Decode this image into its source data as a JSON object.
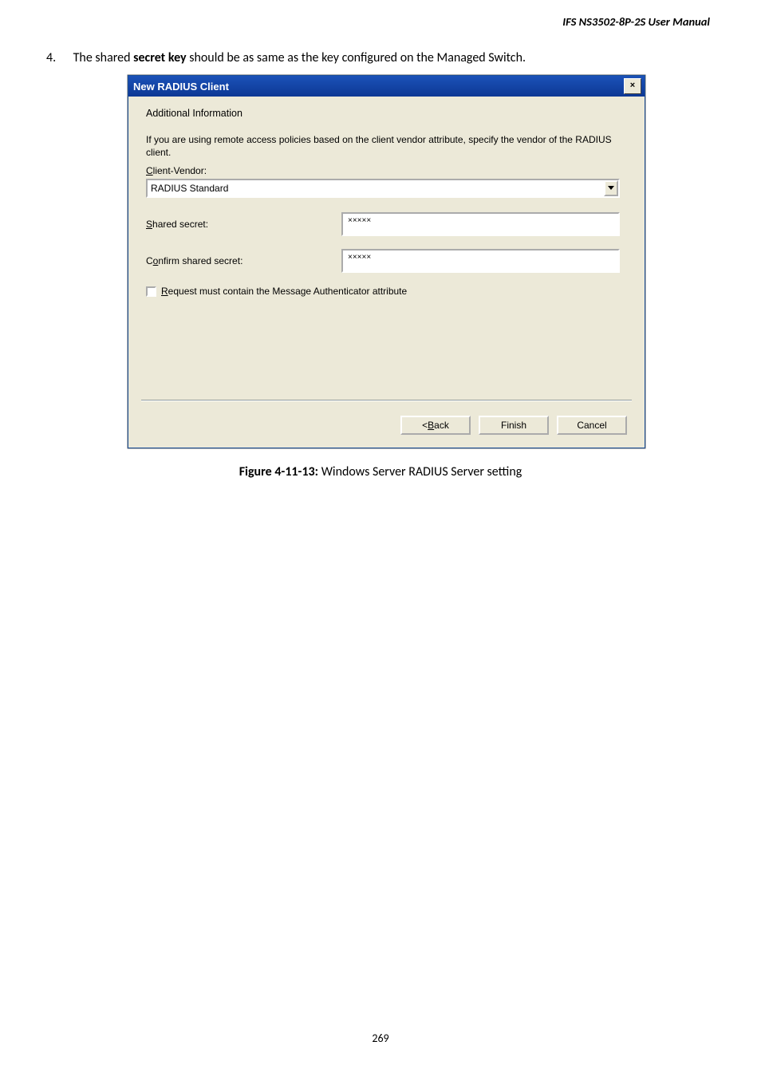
{
  "header": {
    "doc_title": "IFS  NS3502-8P-2S  User  Manual"
  },
  "step": {
    "number": "4.",
    "text_pre": "The shared ",
    "bold": "secret key",
    "text_post": " should be as same as the key configured on the Managed Switch."
  },
  "dialog": {
    "title": "New RADIUS Client",
    "close_x": "×",
    "subheading": "Additional Information",
    "info_text": "If you are using remote access policies based on the client vendor attribute, specify the vendor of the RADIUS client.",
    "client_vendor_label_pre": "C",
    "client_vendor_label_post": "lient-Vendor:",
    "dropdown_value": "RADIUS Standard",
    "shared_secret_label_pre": "S",
    "shared_secret_label_post": "hared secret:",
    "shared_secret_value": "×××××",
    "confirm_label_pre": "C",
    "confirm_label_mid": "o",
    "confirm_label_post": "nfirm shared secret:",
    "confirm_value": "×××××",
    "checkbox_label_pre": "R",
    "checkbox_label_post": "equest must contain the Message Authenticator attribute",
    "back_btn_pre": "< ",
    "back_btn_key": "B",
    "back_btn_post": "ack",
    "finish_btn": "Finish",
    "cancel_btn": "Cancel"
  },
  "caption": {
    "bold": "Figure 4-11-13:",
    "rest": " Windows Server RADIUS Server setting"
  },
  "pagenum": "269"
}
